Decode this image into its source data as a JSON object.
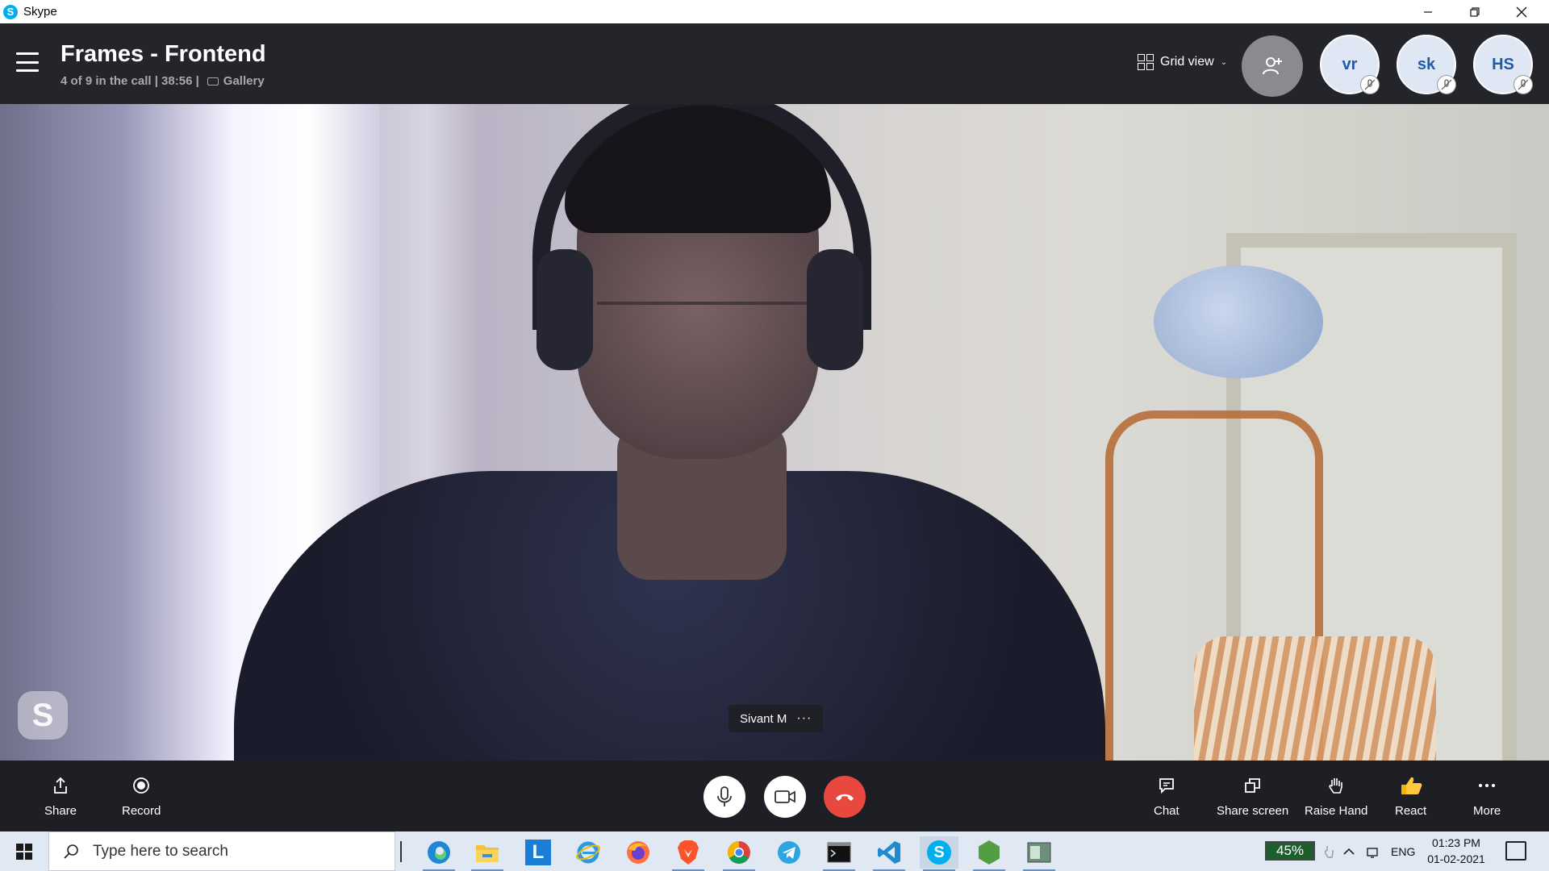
{
  "window": {
    "app_title": "Skype",
    "app_icon": "skype-icon",
    "controls": [
      "minimize-icon",
      "restore-icon",
      "close-icon"
    ]
  },
  "call": {
    "title": "Frames - Frontend",
    "participants_status": "4 of 9 in the call | 38:56 |",
    "gallery_label": "Gallery",
    "view_label": "Grid view",
    "add_person_icon": "add-person-icon",
    "avatars": [
      {
        "initials": "vr",
        "muted": true
      },
      {
        "initials": "sk",
        "muted": true
      },
      {
        "initials": "HS",
        "muted": true
      }
    ]
  },
  "video": {
    "speaker_name": "Sivant M",
    "name_tag_more": "···",
    "watermark": "S"
  },
  "callbar": {
    "share_label": "Share",
    "record_label": "Record",
    "chat_label": "Chat",
    "share_screen_label": "Share screen",
    "raise_hand_label": "Raise Hand",
    "react_label": "React",
    "more_label": "More",
    "end_call_color": "#e8483d"
  },
  "taskbar": {
    "search_placeholder": "Type here to search",
    "apps": [
      "edge-icon",
      "file-explorer-icon",
      "l-app-icon",
      "internet-explorer-icon",
      "firefox-icon",
      "brave-icon",
      "chrome-icon",
      "telegram-icon",
      "terminal-icon",
      "vscode-icon",
      "skype-icon",
      "node-icon",
      "window-app-icon"
    ],
    "l_app_letter": "L",
    "skype_letter": "S",
    "battery": "45%",
    "language": "ENG",
    "time": "01:23 PM",
    "date": "01-02-2021"
  }
}
